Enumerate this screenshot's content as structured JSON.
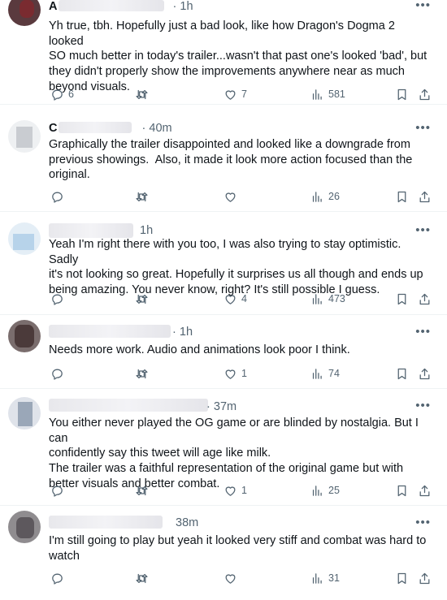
{
  "tweets": [
    {
      "name": "A",
      "time": "· 1h",
      "text": "Yh true, tbh. Hopefully just a bad look, like how Dragon's Dogma 2 looked\nSO much better in today's trailer...wasn't that past one's looked 'bad', but\nthey didn't properly show the improvements anywhere near as much\nbeyond visuals.",
      "replies": "6",
      "reposts": "",
      "likes": "7",
      "views": "581"
    },
    {
      "name": "C",
      "time": "· 40m",
      "text": "Graphically the trailer disappointed and looked like a downgrade from\nprevious showings.  Also, it made it look more action focused than the\noriginal.",
      "replies": "",
      "reposts": "",
      "likes": "",
      "views": "26"
    },
    {
      "name": "",
      "time": "1h",
      "text": "Yeah I'm right there with you too, I was also trying to stay optimistic. Sadly\nit's not looking so great. Hopefully it surprises us all though and ends up\nbeing amazing. You never know, right? It's still possible I guess.",
      "replies": "",
      "reposts": "",
      "likes": "4",
      "views": "473"
    },
    {
      "name": "",
      "time": "· 1h",
      "text": "Needs more work. Audio and animations look poor I think.",
      "replies": "",
      "reposts": "",
      "likes": "1",
      "views": "74"
    },
    {
      "name": "",
      "time": "· 37m",
      "text": "You either never played the OG game or are blinded by nostalgia. But I can\nconfidently say this tweet will age like milk.\nThe trailer was a faithful representation of the original game but with\nbetter visuals and better combat.",
      "replies": "",
      "reposts": "",
      "likes": "1",
      "views": "25"
    },
    {
      "name": "",
      "time": "38m",
      "text": "I'm still going to play but yeah it looked very stiff and combat was hard to\nwatch",
      "replies": "",
      "reposts": "",
      "likes": "",
      "views": "31"
    }
  ],
  "icons": {
    "more": "more-icon",
    "reply": "reply-icon",
    "repost": "repost-icon",
    "like": "heart-icon",
    "views": "views-icon",
    "bookmark": "bookmark-icon",
    "share": "share-icon"
  },
  "colors": {
    "icon": "#536471",
    "text": "#0f1419",
    "divider": "#eff3f4"
  }
}
